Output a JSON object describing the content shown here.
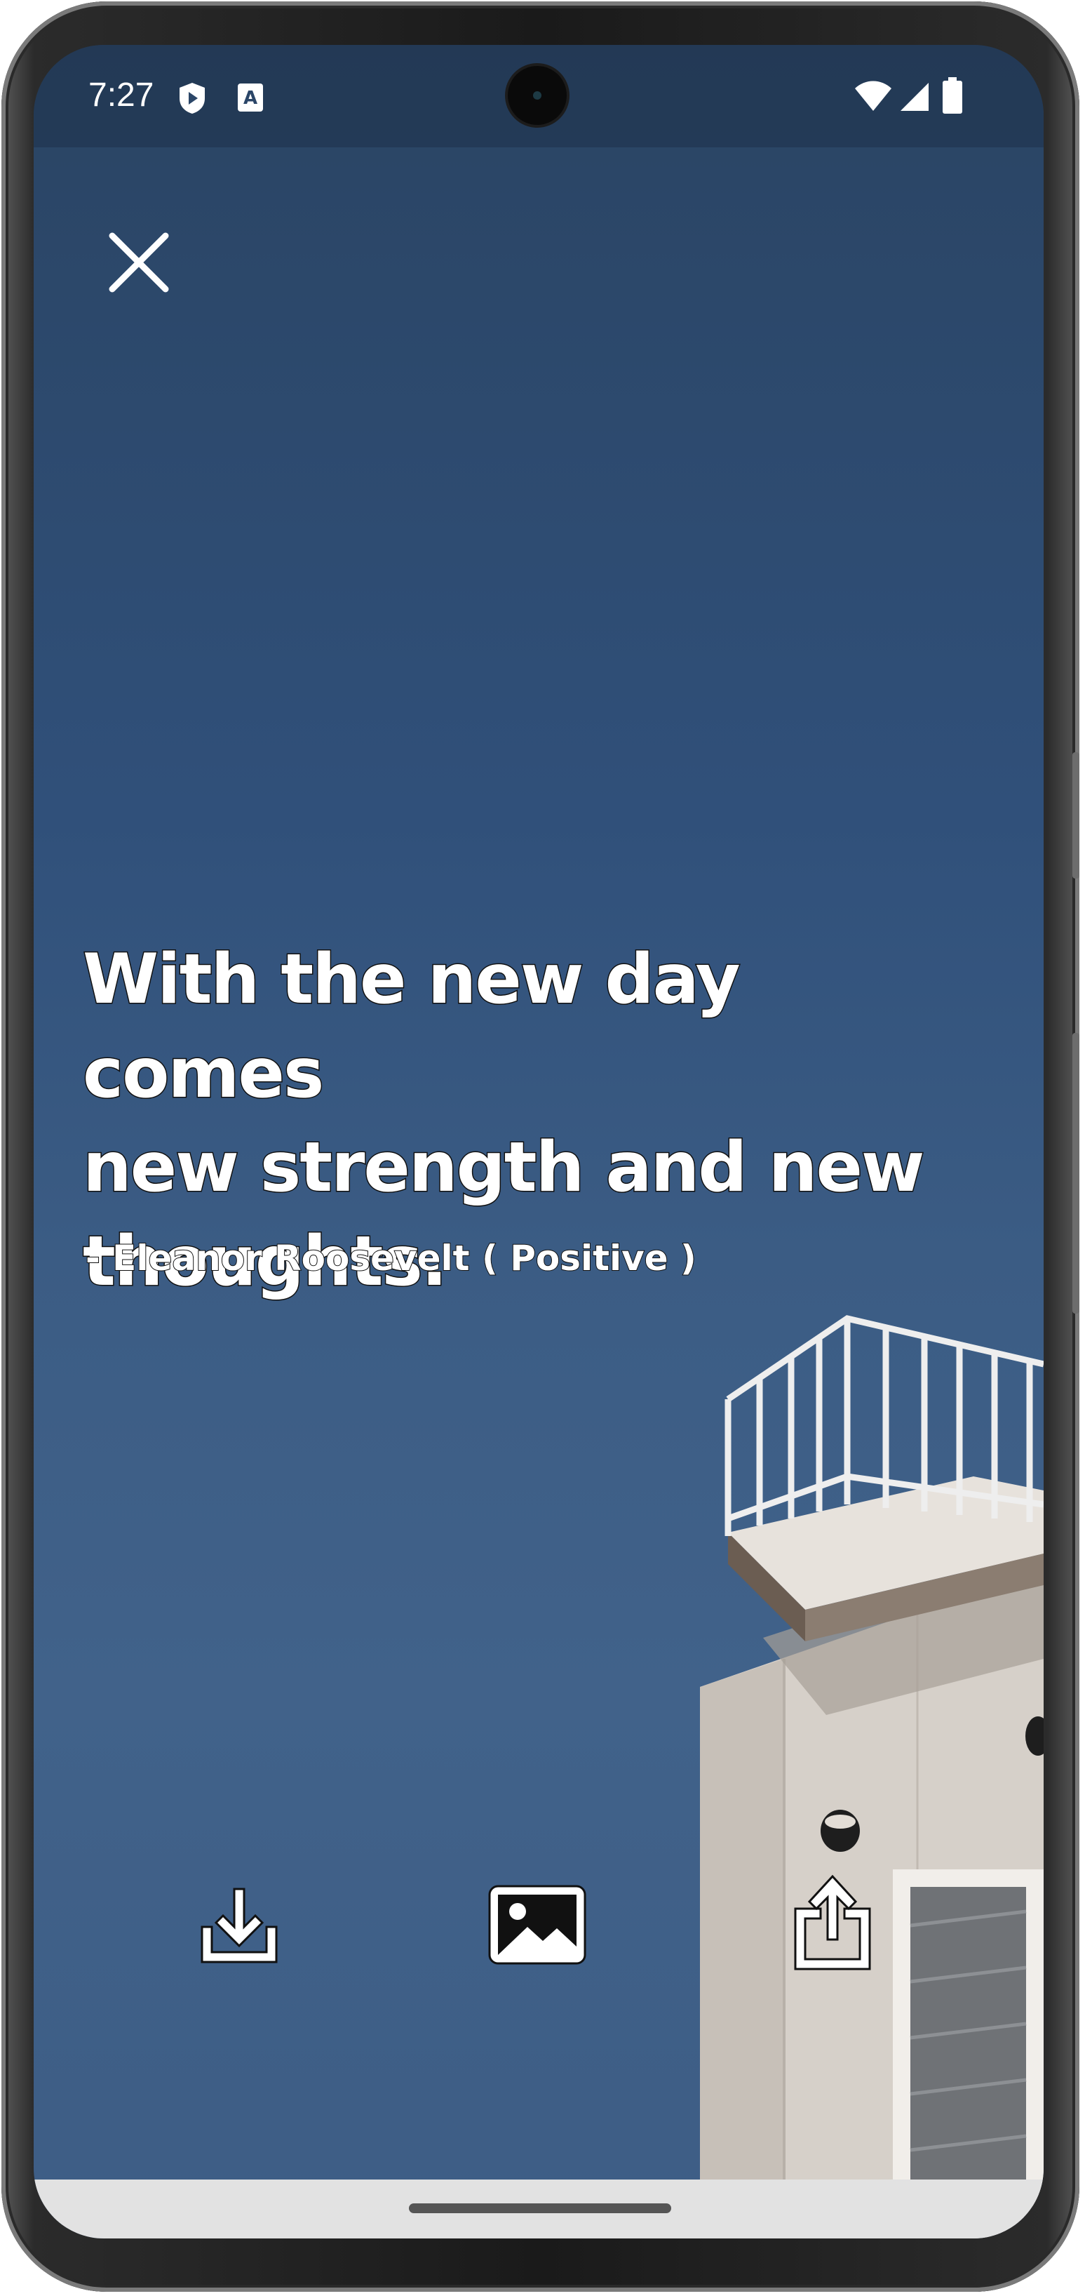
{
  "status_bar": {
    "time": "7:27",
    "icons": [
      "shield-play-icon",
      "translate-a-icon",
      "wifi-icon",
      "signal-icon",
      "battery-icon"
    ]
  },
  "quote": {
    "line1": "With the new day comes",
    "line2": "new strength and new",
    "line3": "thoughts.",
    "attribution": "- Eleanor Roosevelt ( Positive )"
  },
  "actions": [
    "download-icon",
    "image-icon",
    "share-icon"
  ],
  "colors": {
    "sky_top": "#2a4463",
    "sky_bottom": "#41628a",
    "text": "#ffffff",
    "nav_bar": "#e2e2e2"
  }
}
